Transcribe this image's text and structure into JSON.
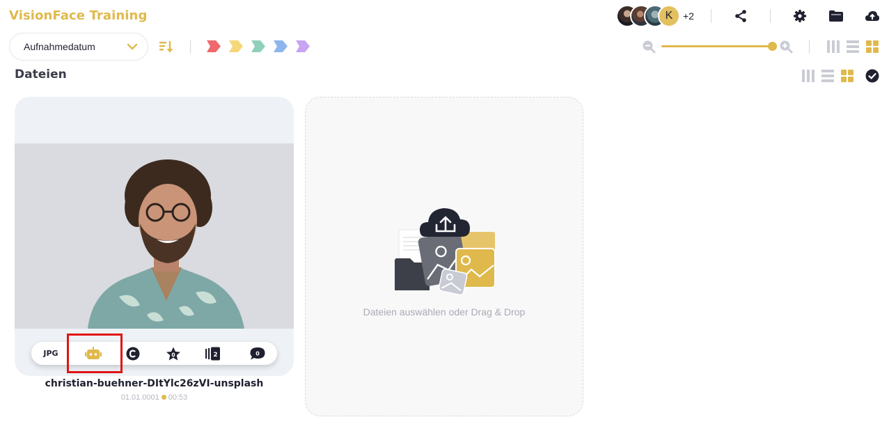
{
  "app": {
    "title": "VisionFace Training"
  },
  "header": {
    "avatar_initial": "K",
    "avatar_more": "+2",
    "icons": [
      "share-icon",
      "gear-icon",
      "folder-icon",
      "cloud-upload-icon"
    ]
  },
  "toolbar": {
    "sort_value": "Aufnahmedatum",
    "tag_colors": [
      "#f0686c",
      "#f5d77a",
      "#8fd0bd",
      "#8db6ef",
      "#c8a4f2"
    ],
    "zoom_level": 1.0
  },
  "section": {
    "title": "Dateien"
  },
  "file": {
    "name": "christian-buehner-DItYlc26zVI-unsplash",
    "date": "01.01.0001",
    "time": "00:53",
    "type": "JPG",
    "rating": "0",
    "versions": "2",
    "comments": "0"
  },
  "upload": {
    "text": "Dateien auswählen oder Drag & Drop"
  },
  "colors": {
    "accent": "#e0b94c",
    "dark": "#1f2130",
    "grey_icon": "#c9ccd3"
  }
}
